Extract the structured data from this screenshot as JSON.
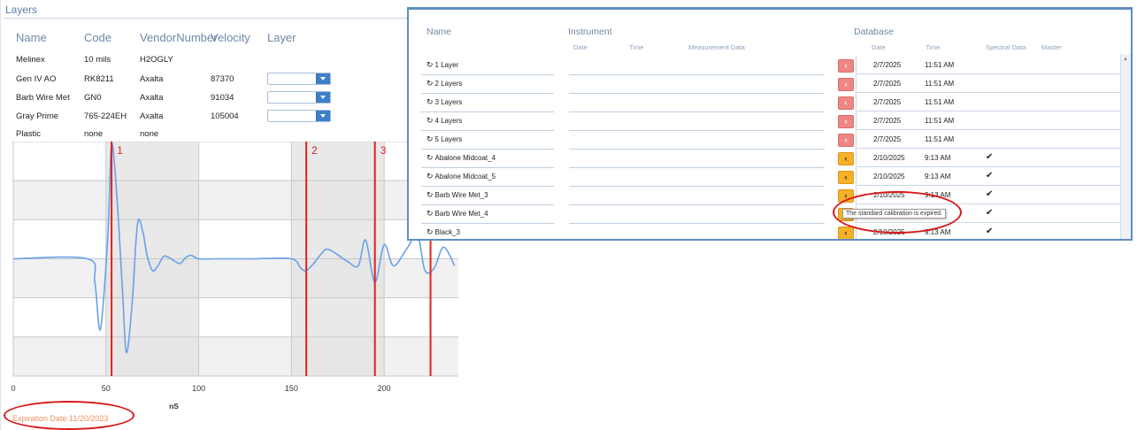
{
  "layers": {
    "title": "Layers",
    "columns": [
      "Name",
      "Code",
      "VendorNumber",
      "Velocity",
      "Layer"
    ],
    "rows": [
      {
        "name": "Melinex",
        "code": "10 mils",
        "vendor": "H2OGLY",
        "velocity": "",
        "has_dropdown": false
      },
      {
        "name": "Gen IV AO",
        "code": "RK8211",
        "vendor": "Axalta",
        "velocity": "87370",
        "has_dropdown": true
      },
      {
        "name": "Barb Wire Met",
        "code": "GN0",
        "vendor": "Axalta",
        "velocity": "91034",
        "has_dropdown": true
      },
      {
        "name": "Gray Prime",
        "code": "765-224EH",
        "vendor": "Axalta",
        "velocity": "105004",
        "has_dropdown": true
      },
      {
        "name": "Plastic",
        "code": "none",
        "vendor": "none",
        "velocity": "",
        "has_dropdown": false
      }
    ],
    "expiration": "Expiration Date 11/20/2023"
  },
  "chart_data": {
    "type": "line",
    "xlabel": "nS",
    "ylabel": "",
    "xlim": [
      0,
      240
    ],
    "ylim": [
      -5,
      5
    ],
    "x_ticks": [
      "0",
      "50",
      "100",
      "150",
      "200"
    ],
    "grid": true,
    "shaded_bands": [
      [
        50,
        100
      ],
      [
        150,
        200
      ]
    ],
    "markers": [
      {
        "label": "1",
        "x": 53
      },
      {
        "label": "2",
        "x": 158
      },
      {
        "label": "3",
        "x": 195
      },
      {
        "label": "",
        "x": 225
      }
    ],
    "series": [
      {
        "color": "#6aa0e8",
        "x": [
          0,
          40,
          44,
          47,
          51,
          53,
          56,
          59,
          61,
          64,
          67,
          70,
          72,
          75,
          78,
          81,
          84,
          87,
          90,
          93,
          96,
          100,
          110,
          130,
          150,
          155,
          158,
          162,
          166,
          170,
          180,
          186,
          190,
          195,
          200,
          205,
          212,
          218,
          222,
          227,
          232,
          238
        ],
        "y": [
          0,
          0,
          -1.0,
          -3.0,
          1.0,
          4.9,
          2.5,
          -1.5,
          -4.0,
          -2.0,
          1.5,
          1.1,
          0.2,
          -0.5,
          -0.3,
          0.1,
          0.05,
          -0.1,
          -0.2,
          0.05,
          0.15,
          0,
          0,
          0,
          0,
          -0.4,
          -0.5,
          -0.2,
          0.2,
          0.4,
          -0.1,
          -0.3,
          0.8,
          -1.0,
          0.6,
          -0.3,
          0.4,
          1.0,
          -0.5,
          -0.4,
          0.5,
          -0.3
        ]
      }
    ]
  },
  "database": {
    "headers": {
      "name": "Name",
      "instrument": "Instrument",
      "database": "Database"
    },
    "instrument_subheaders": [
      "Date",
      "Time",
      "Measurement Data"
    ],
    "database_subheaders": [
      "Date",
      "Time",
      "Spectral Data",
      "Master"
    ],
    "rows": [
      {
        "name": "1 Layer",
        "status": "red",
        "date": "2/7/2025",
        "time": "11:51 AM",
        "spectral": ""
      },
      {
        "name": "2 Layers",
        "status": "red",
        "date": "2/7/2025",
        "time": "11:51 AM",
        "spectral": ""
      },
      {
        "name": "3 Layers",
        "status": "red",
        "date": "2/7/2025",
        "time": "11:51 AM",
        "spectral": ""
      },
      {
        "name": "4 Layers",
        "status": "red",
        "date": "2/7/2025",
        "time": "11:51 AM",
        "spectral": ""
      },
      {
        "name": "5 Layers",
        "status": "red",
        "date": "2/7/2025",
        "time": "11:51 AM",
        "spectral": ""
      },
      {
        "name": "Abalone Midcoat_4",
        "status": "orange",
        "date": "2/10/2025",
        "time": "9:13 AM",
        "spectral": "✔"
      },
      {
        "name": "Abalone Midcoat_5",
        "status": "orange",
        "date": "2/10/2025",
        "time": "9:13 AM",
        "spectral": "✔"
      },
      {
        "name": "Barb Wire Met_3",
        "status": "orange",
        "date": "2/10/2025",
        "time": "9:13 AM",
        "spectral": "✔"
      },
      {
        "name": "Barb Wire Met_4",
        "status": "orange",
        "date": "",
        "time": "AM",
        "spectral": "✔"
      },
      {
        "name": "Black_3",
        "status": "orange",
        "date": "2/10/2025",
        "time": "9:13 AM",
        "spectral": "✔"
      }
    ],
    "tooltip": "The standard calibration is expired.",
    "icons": {
      "row_icon": "refresh-icon",
      "transfer": "chevron-left-icon"
    }
  },
  "colors": {
    "accent": "#5f8fbf",
    "marker": "#e02020",
    "highlight": "#d81818",
    "expire": "#f0925f"
  }
}
